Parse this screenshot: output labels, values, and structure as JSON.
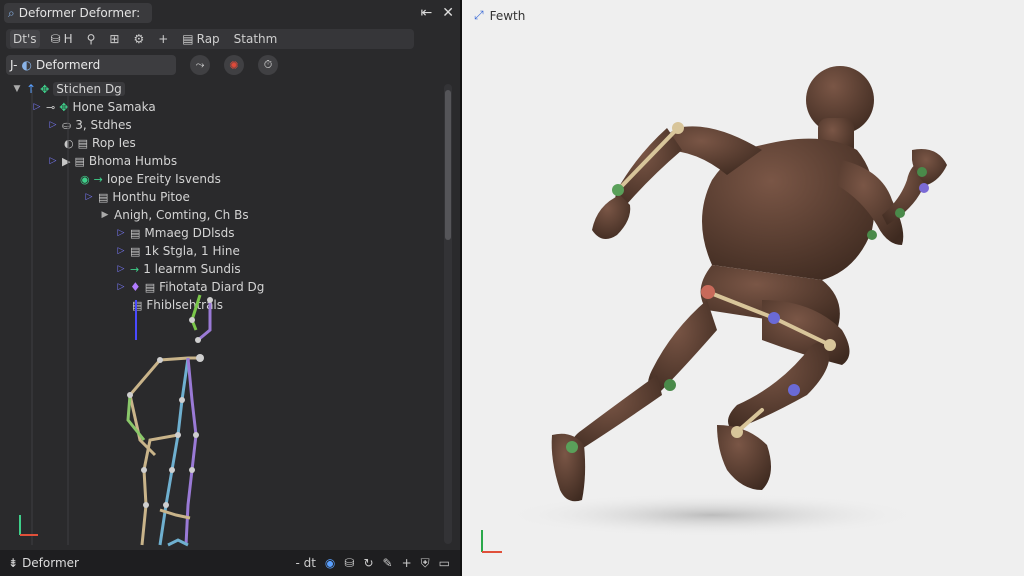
{
  "window": {
    "title": "Deformer Deformer:"
  },
  "toolbar": {
    "items": [
      "Dt's",
      "H",
      "Rap",
      "Stathm"
    ]
  },
  "field": {
    "value": "Deformerd",
    "prefix": "J-"
  },
  "tree": {
    "items": [
      {
        "label": "Stichen Dg"
      },
      {
        "label": "Hone Samaka"
      },
      {
        "label": "3, Stdhes"
      },
      {
        "label": "Rop Ies"
      },
      {
        "label": "Bhoma Humbs"
      },
      {
        "label": "Iope Ereity Isvends"
      },
      {
        "label": "Honthu Pitoe"
      },
      {
        "label": "Anigh, Comting, Ch Bs"
      },
      {
        "label": "Mmaeg DDlsds"
      },
      {
        "label": "1k Stgla, 1 Hine"
      },
      {
        "label": "1 learnm Sundis"
      },
      {
        "label": "Fihotata Diard Dg"
      },
      {
        "label": "Fhiblsehtrals"
      }
    ]
  },
  "status": {
    "label": "Deformer",
    "right_text": "- dt"
  },
  "viewport": {
    "label": "Fewth"
  },
  "colors": {
    "accent": "#3ecf8a",
    "joint_purple": "#7b6bd6",
    "joint_green": "#5aa05a",
    "body": "#5a3e30"
  }
}
